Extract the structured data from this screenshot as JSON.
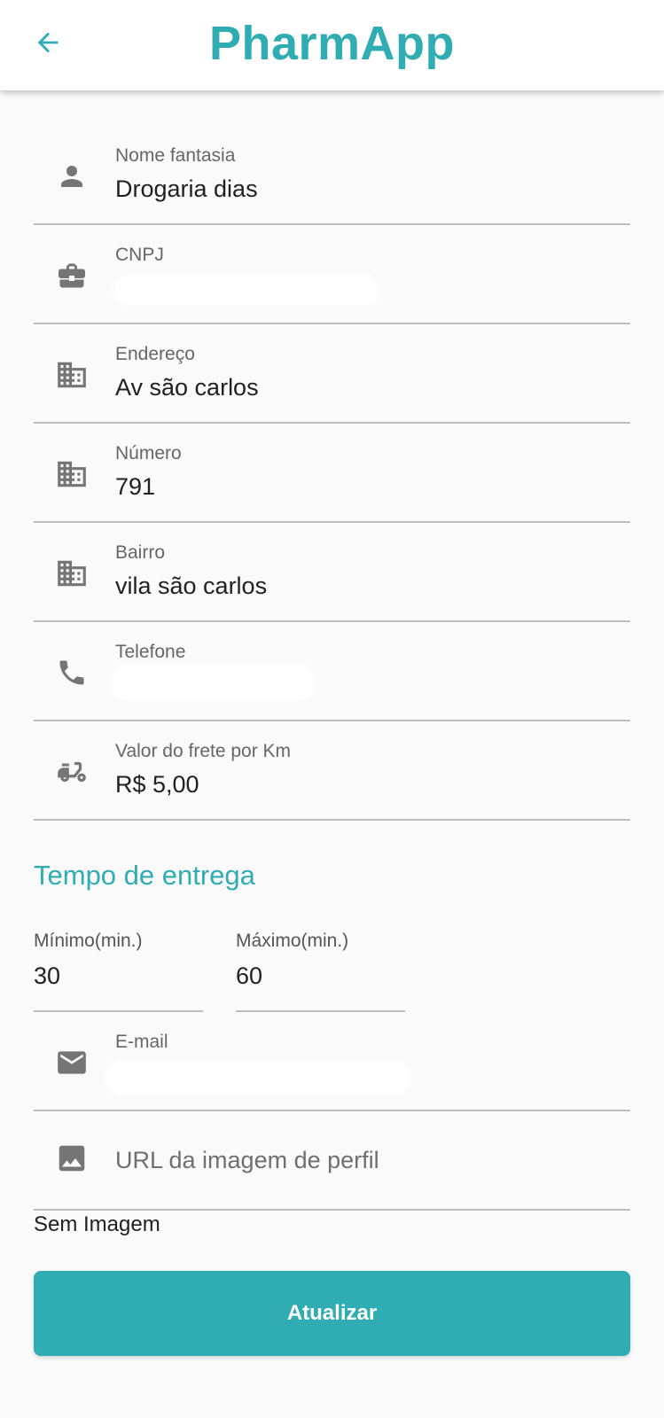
{
  "appbar": {
    "title": "PharmApp",
    "back_icon": "arrow-left-icon"
  },
  "colors": {
    "accent": "#2fadb3",
    "icon": "#757575",
    "divider": "#bdbdbd",
    "background": "#fafafa"
  },
  "fields": [
    {
      "label": "Nome fantasia",
      "value": "Drogaria dias",
      "icon": "person-icon"
    },
    {
      "label": "CNPJ",
      "value": "",
      "icon": "briefcase-icon",
      "redacted": true
    },
    {
      "label": "Endereço",
      "value": "Av são carlos",
      "icon": "building-icon"
    },
    {
      "label": "Número",
      "value": "791",
      "icon": "building-icon"
    },
    {
      "label": "Bairro",
      "value": "vila são carlos",
      "icon": "building-icon"
    },
    {
      "label": "Telefone",
      "value": "",
      "icon": "phone-icon",
      "redacted": true
    },
    {
      "label": "Valor do frete por Km",
      "value": "R$ 5,00",
      "icon": "scooter-icon"
    }
  ],
  "delivery": {
    "title": "Tempo de entrega",
    "min_label": "Mínimo(min.)",
    "min_value": "30",
    "max_label": "Máximo(min.)",
    "max_value": "60"
  },
  "email": {
    "label": "E-mail",
    "value": "",
    "icon": "mail-icon",
    "redacted": true
  },
  "image_url": {
    "placeholder": "URL da imagem de perfil",
    "icon": "image-icon"
  },
  "no_image_text": "Sem Imagem",
  "submit_label": "Atualizar"
}
